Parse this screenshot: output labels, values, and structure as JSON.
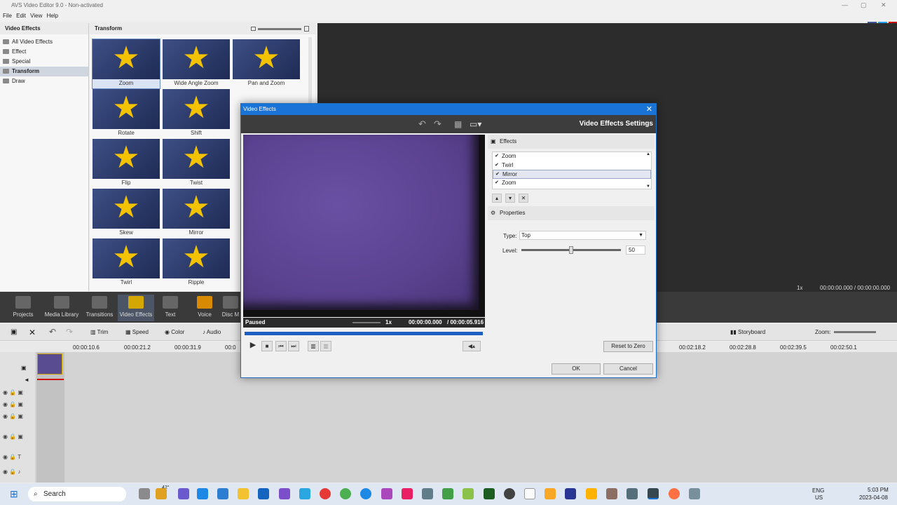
{
  "app": {
    "title": "AVS Video Editor 9.0 - Non-activated",
    "menu": [
      "File",
      "Edit",
      "View",
      "Help"
    ]
  },
  "left_panel": {
    "header": "Video Effects",
    "categories": [
      "All Video Effects",
      "Effect",
      "Special",
      "Transform",
      "Draw"
    ],
    "selected": "Transform"
  },
  "gallery": {
    "header": "Transform",
    "items": [
      "Zoom",
      "Wide Angle Zoom",
      "Pan and Zoom",
      "Rotate",
      "Shift",
      "Flip",
      "Twist",
      "Skew",
      "Mirror",
      "Twirl",
      "Ripple"
    ]
  },
  "main_toolbar": {
    "items": [
      "Projects",
      "Media Library",
      "Transitions",
      "Video Effects",
      "Text",
      "Voice",
      "Disc M"
    ],
    "active": "Video Effects"
  },
  "preview_top": {
    "speed": "1x",
    "time": "00:00:00.000 / 00:00:00.000"
  },
  "edit_bar": {
    "trim": "Trim",
    "speed": "Speed",
    "color": "Color",
    "audio": "Audio",
    "storyboard": "Storyboard",
    "zoom": "Zoom:"
  },
  "ruler": {
    "left_ticks": [
      "00:00:10.6",
      "00:00:21.2",
      "00:00:31.9",
      "00:0"
    ],
    "right_ticks": [
      "00:02:18.2",
      "00:02:28.8",
      "00:02:39.5",
      "00:02:50.1"
    ]
  },
  "dialog": {
    "title": "Video Effects",
    "settings_title": "Video Effects Settings",
    "status": "Paused",
    "speed": "1x",
    "time": "00:00:00.000",
    "duration": "/ 00:00:05.916",
    "effects_header": "Effects",
    "effects": [
      "Zoom",
      "Twirl",
      "Mirror",
      "Zoom"
    ],
    "selected_effect": "Mirror",
    "properties_header": "Properties",
    "type_label": "Type:",
    "type_value": "Top",
    "level_label": "Level:",
    "level_value": "50",
    "level_fraction": 0.5,
    "reset_label": "Reset to Zero",
    "ok_label": "OK",
    "cancel_label": "Cancel"
  },
  "taskbar": {
    "search": "Search",
    "weather": "42°",
    "lang1": "ENG",
    "lang2": "US",
    "time": "5:03 PM",
    "date": "2023-04-08"
  }
}
